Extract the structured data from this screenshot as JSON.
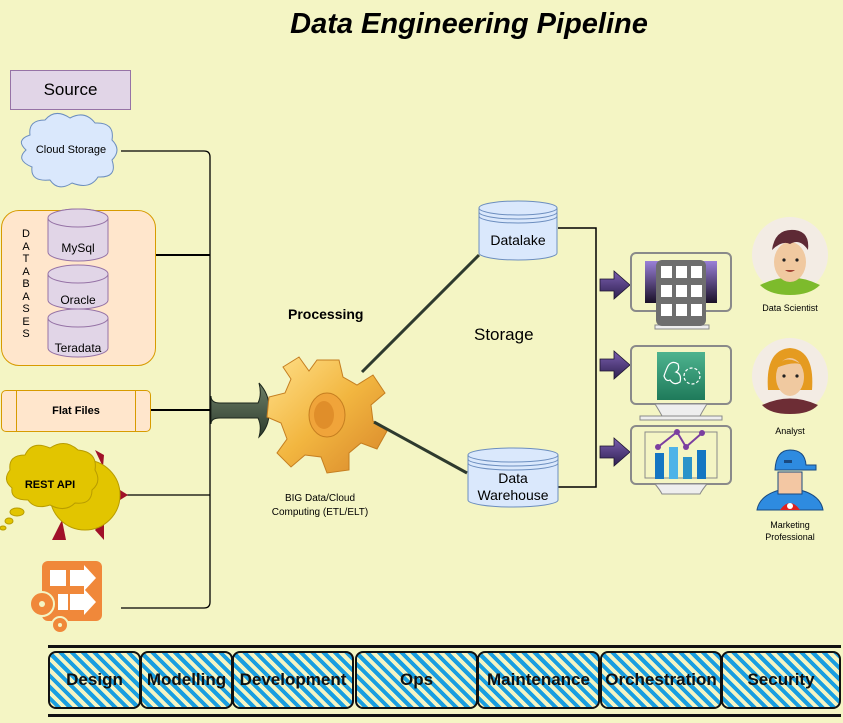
{
  "title": "Data Engineering Pipeline",
  "source": {
    "header": "Source",
    "cloud_storage": "Cloud Storage",
    "databases_label": [
      "D",
      "A",
      "T",
      "A",
      "B",
      "A",
      "S",
      "E",
      "S"
    ],
    "databases": [
      "MySql",
      "Oracle",
      "Teradata"
    ],
    "flat_files": "Flat Files",
    "rest_api": "REST API",
    "etl_tool_icon": "orange-etl-gears-icon"
  },
  "processing": {
    "header": "Processing",
    "engine_icon": "gold-gear-icon",
    "caption_line1": "BIG Data/Cloud",
    "caption_line2": "Computing (ETL/ELT)"
  },
  "storage": {
    "header": "Storage",
    "datalake": "Datalake",
    "warehouse_line1": "Data",
    "warehouse_line2": "Warehouse"
  },
  "consumers": {
    "monitors": [
      {
        "icon": "app-grid-icon"
      },
      {
        "icon": "ml-brain-gear-icon"
      },
      {
        "icon": "bar-line-chart-icon"
      }
    ],
    "roles": [
      {
        "label": "Data Scientist",
        "icon": "man-avatar-icon"
      },
      {
        "label": "Analyst",
        "icon": "woman-avatar-icon"
      },
      {
        "label_line1": "Marketing",
        "label_line2": "Professional",
        "icon": "cap-man-avatar-icon"
      }
    ]
  },
  "phases": [
    "Design",
    "Modelling",
    "Development",
    "Ops",
    "Maintenance",
    "Orchestration",
    "Security"
  ],
  "colors": {
    "background": "#f4f5c4",
    "source_fill": "#e1d5e7",
    "cloud_fill": "#dae8fc",
    "group_fill": "#ffe6cc",
    "phase_stripe": "#1a9ee0",
    "arrow_purple": "#4b3a78"
  }
}
